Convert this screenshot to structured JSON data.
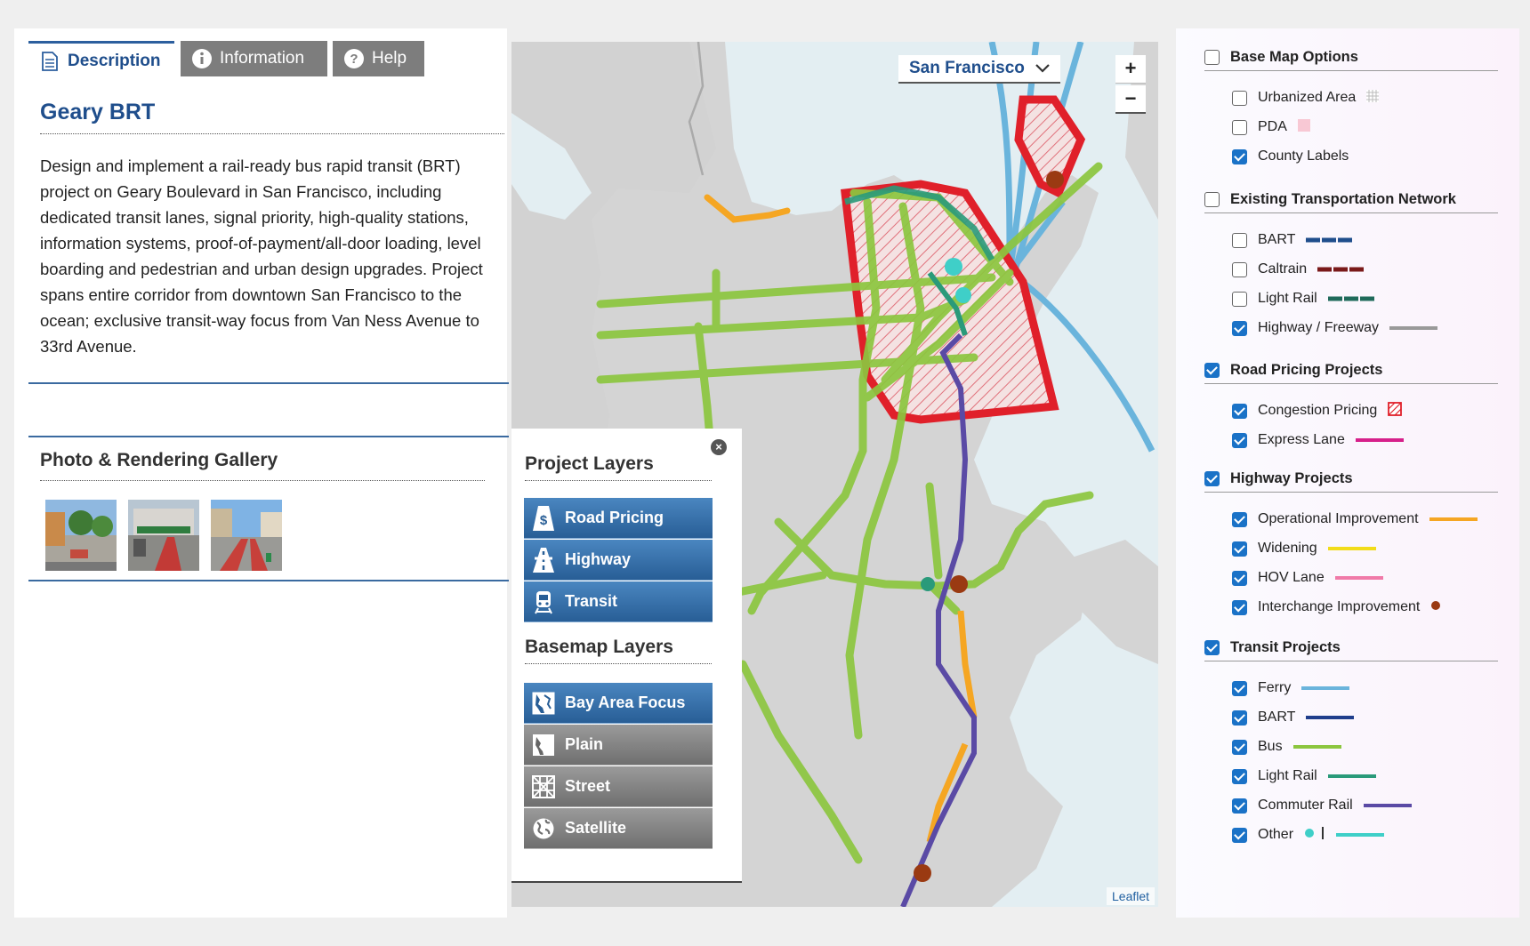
{
  "tabs": [
    {
      "label": "Description",
      "icon": "document-icon",
      "active": true
    },
    {
      "label": "Information",
      "icon": "info-icon",
      "active": false
    },
    {
      "label": "Help",
      "icon": "help-icon",
      "active": false
    }
  ],
  "project": {
    "title": "Geary BRT",
    "description": "Design and implement a rail-ready bus rapid transit (BRT) project on Geary Boulevard in San Francisco, including dedicated transit lanes, signal priority, high-quality stations, information systems, proof-of-payment/all-door loading, level boarding and pedestrian and urban design upgrades. Project spans entire corridor from downtown San Francisco to the ocean; exclusive transit-way focus from Van Ness Avenue to 33rd Avenue."
  },
  "gallery": {
    "title": "Photo & Rendering Gallery",
    "photos": [
      "photo-1",
      "photo-2",
      "photo-3"
    ]
  },
  "map": {
    "selected_city": "San Francisco",
    "zoom_in": "+",
    "zoom_out": "−",
    "attribution": "Leaflet"
  },
  "layers_panel": {
    "close": "×",
    "project_title": "Project Layers",
    "project_layers": [
      {
        "label": "Road Pricing",
        "icon": "dollar-sign-icon"
      },
      {
        "label": "Highway",
        "icon": "highway-icon"
      },
      {
        "label": "Transit",
        "icon": "train-icon"
      }
    ],
    "basemap_title": "Basemap Layers",
    "basemap_layers": [
      {
        "label": "Bay Area Focus",
        "icon": "bay-area-icon",
        "active": true
      },
      {
        "label": "Plain",
        "icon": "plain-map-icon",
        "active": false
      },
      {
        "label": "Street",
        "icon": "street-grid-icon",
        "active": false
      },
      {
        "label": "Satellite",
        "icon": "globe-icon",
        "active": false
      }
    ]
  },
  "legend": {
    "sections": [
      {
        "label": "Base Map Options",
        "checked": false,
        "items": [
          {
            "label": "Urbanized Area",
            "checked": false
          },
          {
            "label": "PDA",
            "checked": false
          },
          {
            "label": "County Labels",
            "checked": true
          }
        ]
      },
      {
        "label": "Existing Transportation Network",
        "checked": false,
        "items": [
          {
            "label": "BART",
            "checked": false
          },
          {
            "label": "Caltrain",
            "checked": false
          },
          {
            "label": "Light Rail",
            "checked": false
          },
          {
            "label": "Highway / Freeway",
            "checked": true
          }
        ]
      },
      {
        "label": "Road Pricing Projects",
        "checked": true,
        "items": [
          {
            "label": "Congestion Pricing",
            "checked": true
          },
          {
            "label": "Express Lane",
            "checked": true
          }
        ]
      },
      {
        "label": "Highway Projects",
        "checked": true,
        "items": [
          {
            "label": "Operational Improvement",
            "checked": true
          },
          {
            "label": "Widening",
            "checked": true
          },
          {
            "label": "HOV Lane",
            "checked": true
          },
          {
            "label": "Interchange Improvement",
            "checked": true
          }
        ]
      },
      {
        "label": "Transit Projects",
        "checked": true,
        "items": [
          {
            "label": "Ferry",
            "checked": true
          },
          {
            "label": "BART",
            "checked": true
          },
          {
            "label": "Bus",
            "checked": true
          },
          {
            "label": "Light Rail",
            "checked": true
          },
          {
            "label": "Commuter Rail",
            "checked": true
          },
          {
            "label": "Other",
            "checked": true
          }
        ]
      }
    ]
  },
  "colors": {
    "accent": "#1f4e8c",
    "congestion_pricing": "#e0202a",
    "bus": "#8cc63f",
    "ferry": "#6ab4dc",
    "commuter_rail": "#5a4aa5",
    "light_rail": "#2a9a7a",
    "operational_improvement": "#f5a623",
    "interchange": "#9a3a12"
  }
}
